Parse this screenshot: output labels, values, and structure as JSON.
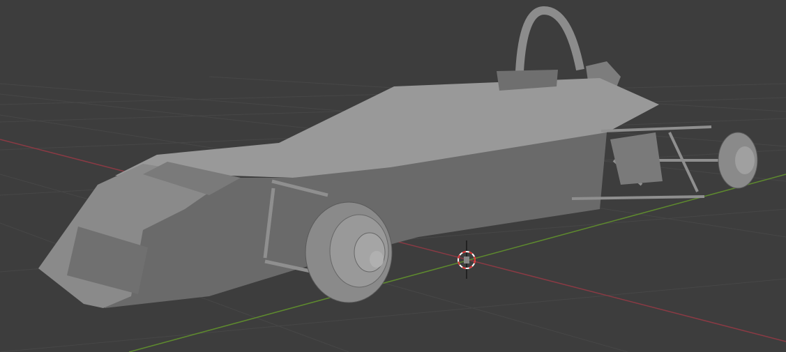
{
  "viewport": {
    "background": "#3d3d3d",
    "grid_color": "#474747",
    "x_axis_color": "#8a3a44",
    "y_axis_color": "#5e8a2e",
    "model": "formula-car-mesh",
    "cursor": "3d-cursor-icon"
  }
}
